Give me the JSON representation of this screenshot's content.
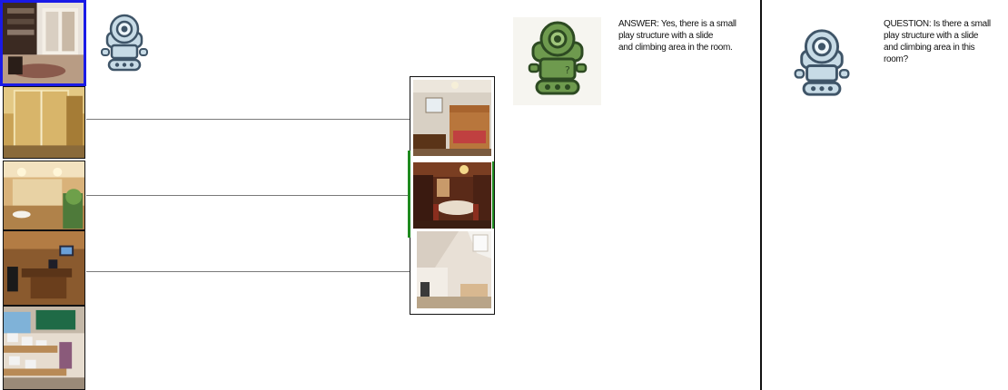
{
  "left_column": {
    "images": [
      {
        "name": "walk-in-closet",
        "selected": true
      },
      {
        "name": "glass-shower-bathroom",
        "selected": false
      },
      {
        "name": "vanity-bathroom",
        "selected": false
      },
      {
        "name": "computer-office",
        "selected": false
      },
      {
        "name": "computer-classroom",
        "selected": false
      }
    ]
  },
  "middle_column": {
    "images": [
      {
        "name": "bunk-bed-bedroom",
        "highlighted": false
      },
      {
        "name": "dining-room",
        "highlighted": true
      },
      {
        "name": "attic-bedroom",
        "highlighted": false
      }
    ]
  },
  "answer_panel": {
    "bot_icon": "green-robot-icon",
    "text_lines": [
      "ANSWER: Yes, there is a small",
      "play structure with a slide",
      "and climbing area in the room."
    ]
  },
  "question_panel": {
    "bot_icon": "blue-robot-icon",
    "text_lines": [
      "QUESTION: Is there a small",
      "play structure with a slide",
      "and climbing area in this",
      "room?"
    ]
  },
  "colors": {
    "selection": "#1a1ae6",
    "highlight": "#1e8a1e",
    "connector": "#7a7a7a",
    "divider": "#111111"
  }
}
